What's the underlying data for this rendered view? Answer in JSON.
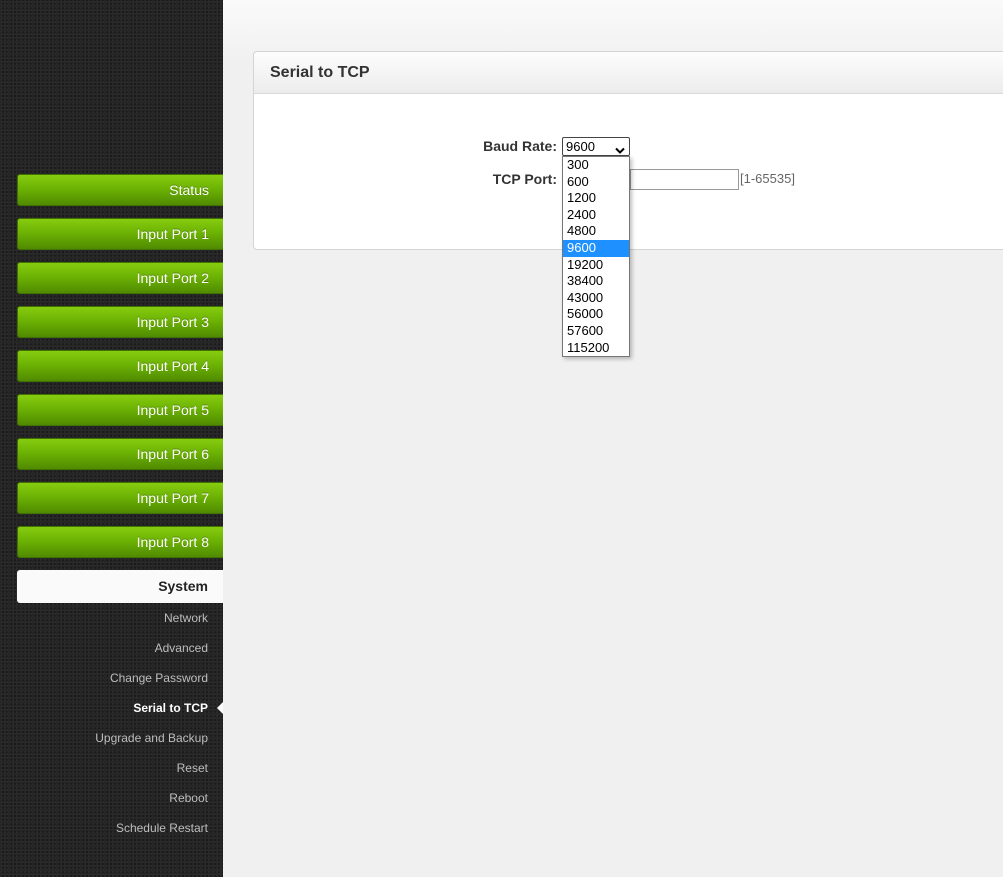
{
  "sidebar": {
    "nav": [
      "Status",
      "Input Port 1",
      "Input Port 2",
      "Input Port 3",
      "Input Port 4",
      "Input Port 5",
      "Input Port 6",
      "Input Port 7",
      "Input Port 8"
    ],
    "active": "System",
    "sub": [
      "Network",
      "Advanced",
      "Change Password",
      "Serial to TCP",
      "Upgrade and Backup",
      "Reset",
      "Reboot",
      "Schedule Restart"
    ],
    "current_sub": "Serial to TCP"
  },
  "panel": {
    "title": "Serial to TCP",
    "baud_label": "Baud Rate:",
    "baud_value": "9600",
    "tcp_label": "TCP Port:",
    "tcp_value": "",
    "tcp_hint": "[1-65535]"
  },
  "dropdown": {
    "options": [
      "300",
      "600",
      "1200",
      "2400",
      "4800",
      "9600",
      "19200",
      "38400",
      "43000",
      "56000",
      "57600",
      "115200"
    ],
    "selected": "9600"
  },
  "colors": {
    "nav_green": "#6db304",
    "highlight": "#1e90ff"
  },
  "icons": {
    "select_arrow": "chevron-down-icon",
    "active_caret": "caret-left-icon"
  }
}
